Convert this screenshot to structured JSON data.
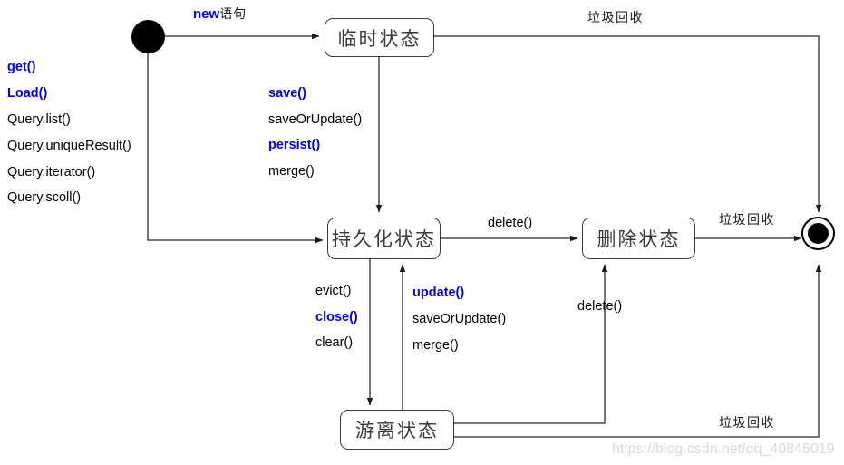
{
  "diagram": {
    "title": "Hibernate object state transition diagram",
    "stroke_color": "#3a3a3a",
    "accent_color": "#0000ee",
    "text_color": "#000000"
  },
  "states": {
    "initial": {
      "name": "initial-state",
      "label": ""
    },
    "transient": {
      "label": "临时状态"
    },
    "persistent": {
      "label": "持久化状态"
    },
    "removed": {
      "label": "删除状态"
    },
    "detached": {
      "label": "游离状态"
    },
    "final": {
      "name": "final-state",
      "label": ""
    }
  },
  "transitions": {
    "new_statement": {
      "bold": "new",
      "tail": "语句"
    },
    "load_group": [
      {
        "text": "get()",
        "bold": true
      },
      {
        "text": "Load()",
        "bold": true
      },
      {
        "text": "Query.list()",
        "bold": false
      },
      {
        "text": "Query.uniqueResult()",
        "bold": false
      },
      {
        "text": "Query.iterator()",
        "bold": false
      },
      {
        "text": "Query.scoll()",
        "bold": false
      }
    ],
    "save_group": [
      {
        "text": "save()",
        "bold": true
      },
      {
        "text": "saveOrUpdate()",
        "bold": false
      },
      {
        "text": "persist()",
        "bold": true
      },
      {
        "text": "merge()",
        "bold": false
      }
    ],
    "evict_group": [
      {
        "text": "evict()",
        "bold": false
      },
      {
        "text": "close()",
        "bold": true
      },
      {
        "text": "clear()",
        "bold": false
      }
    ],
    "update_group": [
      {
        "text": "update()",
        "bold": true
      },
      {
        "text": "saveOrUpdate()",
        "bold": false
      },
      {
        "text": "merge()",
        "bold": false
      }
    ],
    "delete_persistent_to_removed": "delete()",
    "delete_detached_to_removed": "delete()",
    "gc_transient": "垃圾回收",
    "gc_removed": "垃圾回收",
    "gc_detached": "垃圾回收"
  },
  "watermark": {
    "text": "https://blog.csdn.net/qq_40845019"
  }
}
